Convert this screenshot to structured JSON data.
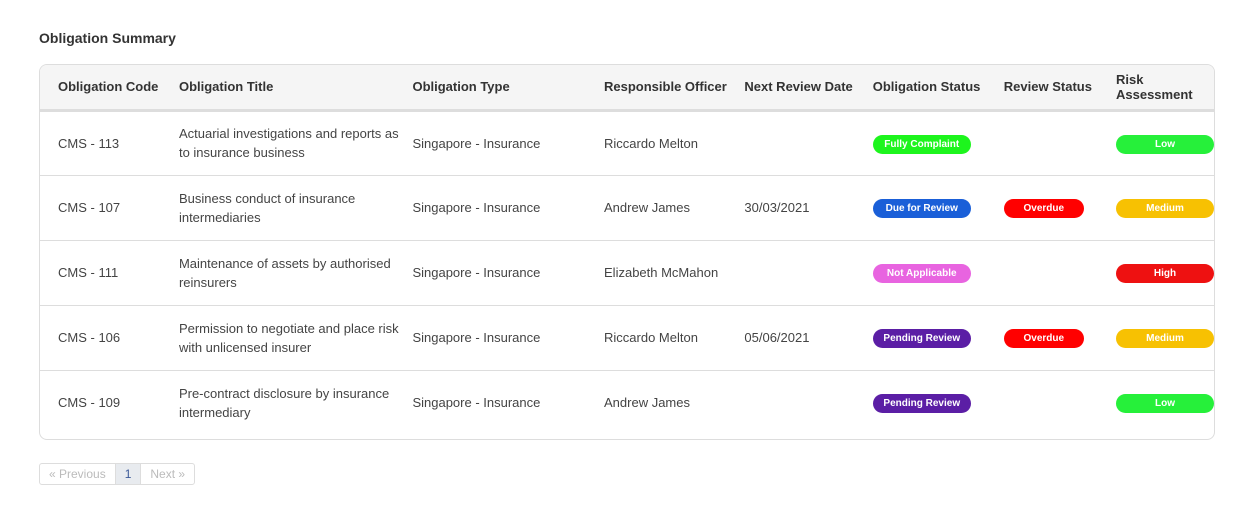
{
  "section_title": "Obligation Summary",
  "columns": [
    "Obligation Code",
    "Obligation Title",
    "Obligation Type",
    "Responsible Officer",
    "Next Review Date",
    "Obligation Status",
    "Review Status",
    "Risk Assessment"
  ],
  "rows": [
    {
      "code": "CMS - 113",
      "title": "Actuarial investigations and reports as to insurance business",
      "type": "Singapore - Insurance",
      "officer": "Riccardo Melton",
      "date": "",
      "status": {
        "label": "Fully Complaint",
        "color": "#1df51d"
      },
      "review": null,
      "risk": {
        "label": "Low",
        "color": "#26f03a"
      }
    },
    {
      "code": "CMS - 107",
      "title": "Business conduct of insurance intermediaries",
      "type": "Singapore - Insurance",
      "officer": "Andrew James",
      "date": "30/03/2021",
      "status": {
        "label": "Due for Review",
        "color": "#1a5fd8"
      },
      "review": {
        "label": "Overdue",
        "color": "#ff0000"
      },
      "risk": {
        "label": "Medium",
        "color": "#f7c102"
      }
    },
    {
      "code": "CMS - 111",
      "title": "Maintenance of assets by authorised reinsurers",
      "type": "Singapore - Insurance",
      "officer": "Elizabeth McMahon",
      "date": "",
      "status": {
        "label": "Not Applicable",
        "color": "#e864e0"
      },
      "review": null,
      "risk": {
        "label": "High",
        "color": "#ee1111"
      }
    },
    {
      "code": "CMS - 106",
      "title": "Permission to negotiate and place risk with unlicensed insurer",
      "type": "Singapore - Insurance",
      "officer": "Riccardo Melton",
      "date": "05/06/2021",
      "status": {
        "label": "Pending Review",
        "color": "#5b1ea5"
      },
      "review": {
        "label": "Overdue",
        "color": "#ff0000"
      },
      "risk": {
        "label": "Medium",
        "color": "#f7c102"
      }
    },
    {
      "code": "CMS - 109",
      "title": "Pre-contract disclosure by insurance intermediary",
      "type": "Singapore - Insurance",
      "officer": "Andrew James",
      "date": "",
      "status": {
        "label": "Pending Review",
        "color": "#5b1ea5"
      },
      "review": null,
      "risk": {
        "label": "Low",
        "color": "#26f03a"
      }
    }
  ],
  "pagination": {
    "previous": "« Previous",
    "current": "1",
    "next": "Next »"
  }
}
